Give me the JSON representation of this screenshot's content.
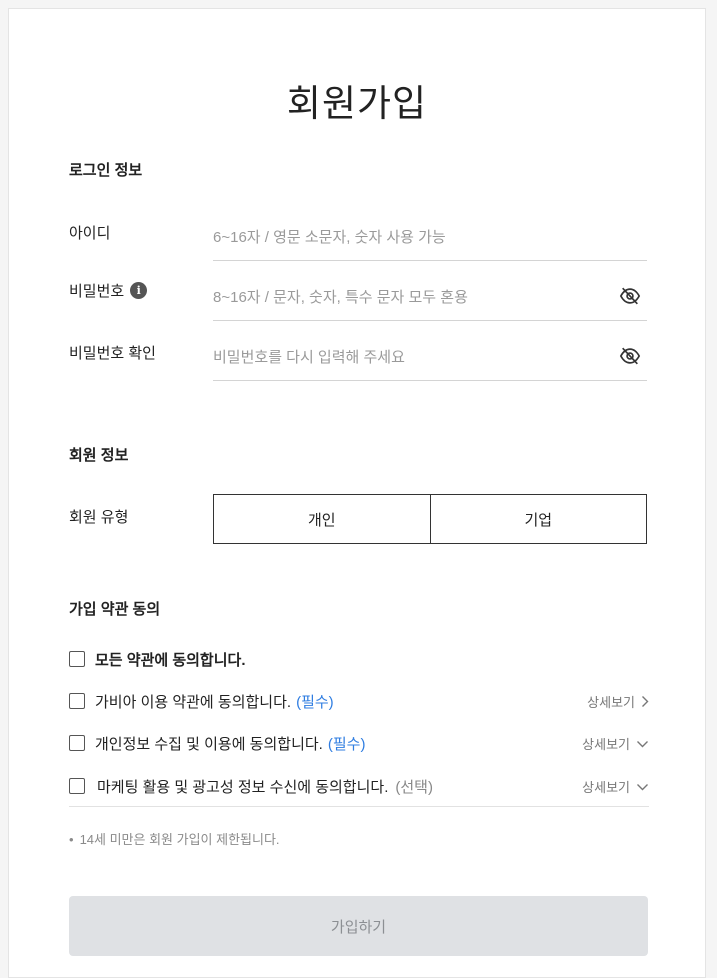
{
  "page": {
    "title": "회원가입"
  },
  "login_section": {
    "title": "로그인 정보",
    "id_label": "아이디",
    "id_placeholder": "6~16자 / 영문 소문자, 숫자 사용 가능",
    "id_value": "",
    "password_label": "비밀번호",
    "password_placeholder": "8~16자 / 문자, 숫자, 특수 문자 모두 혼용",
    "password_value": "",
    "password_confirm_label": "비밀번호 확인",
    "password_confirm_placeholder": "비밀번호를 다시 입력해 주세요",
    "password_confirm_value": "",
    "info_icon_glyph": "i",
    "icons": [
      "info-icon",
      "eye-slash-icon"
    ]
  },
  "member_section": {
    "title": "회원 정보",
    "type_label": "회원 유형",
    "types": [
      "개인",
      "기업"
    ]
  },
  "terms_section": {
    "title": "가입 약관 동의",
    "agree_all": "모든 약관에 동의합니다.",
    "items": [
      {
        "text": "가비아 이용 약관에 동의합니다.",
        "tag": "(필수)",
        "detail": "상세보기",
        "detail_icon": "chevron-right-icon"
      },
      {
        "text": "개인정보 수집 및 이용에 동의합니다.",
        "tag": "(필수)",
        "detail": "상세보기",
        "detail_icon": "chevron-down-icon"
      },
      {
        "text": "마케팅 활용 및 광고성 정보 수신에 동의합니다.",
        "tag": "(선택)",
        "detail": "상세보기",
        "detail_icon": "chevron-down-icon"
      }
    ],
    "notice_bullet": "•",
    "notice": "14세 미만은 회원 가입이 제한됩니다."
  },
  "submit": {
    "label": "가입하기"
  },
  "colors": {
    "required_tag": "#2f7de1",
    "submit_bg": "#dfe1e4",
    "submit_text": "#8c8f93",
    "divider": "#d4d4d4"
  }
}
